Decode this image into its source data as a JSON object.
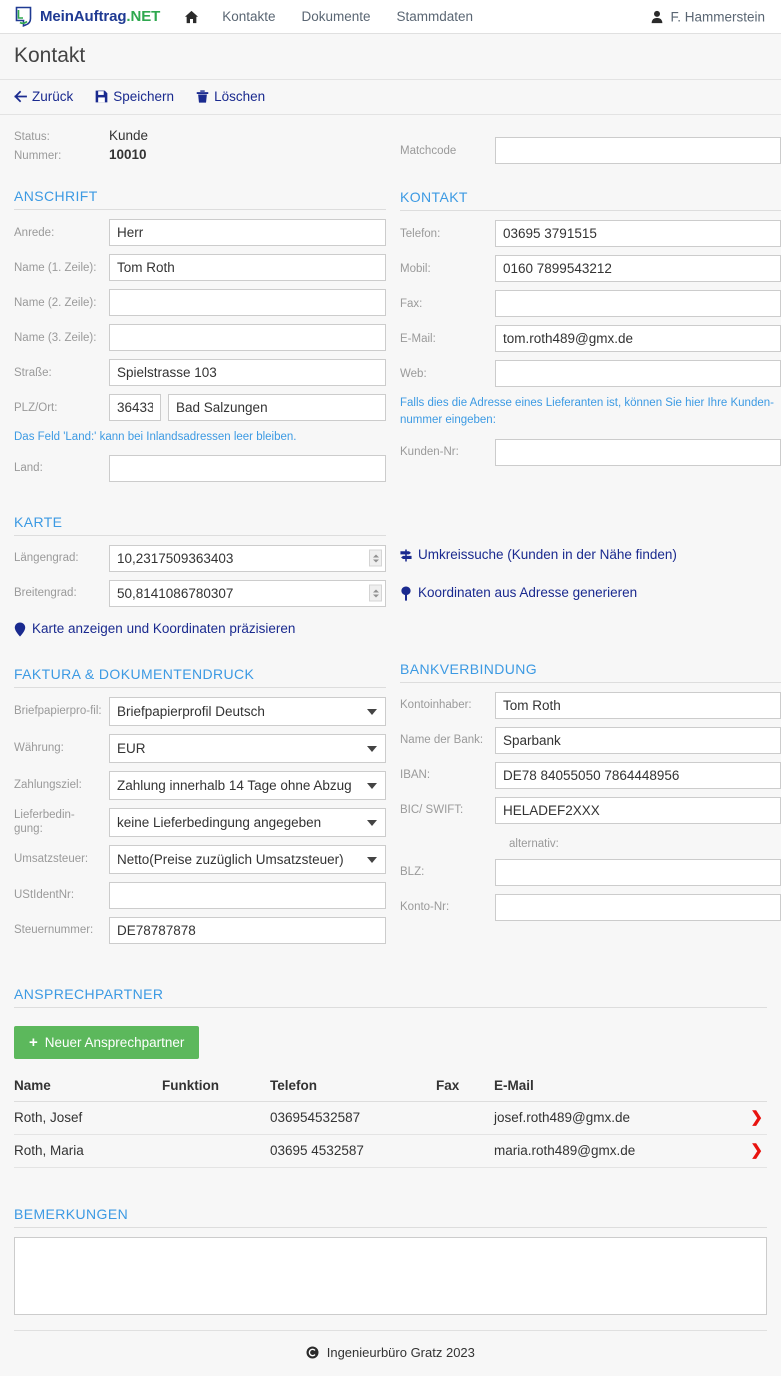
{
  "navbar": {
    "brand_main": "MeinAuftrag",
    "brand_suffix": ".NET",
    "brand_logo_icon": "speech-bubble-logo-icon",
    "home_icon": "home-icon",
    "links": [
      {
        "label": "Kontakte"
      },
      {
        "label": "Dokumente"
      },
      {
        "label": "Stammdaten"
      }
    ],
    "user": {
      "name": "F. Hammerstein",
      "icon": "user-icon"
    }
  },
  "page": {
    "title": "Kontakt"
  },
  "toolbar": {
    "back_label": "Zurück",
    "back_icon": "arrow-left-icon",
    "save_label": "Speichern",
    "save_icon": "floppy-disk-icon",
    "delete_label": "Löschen",
    "delete_icon": "trash-icon"
  },
  "meta": {
    "status_label": "Status:",
    "status_value": "Kunde",
    "number_label": "Nummer:",
    "number_value": "10010"
  },
  "matchcode": {
    "label": "Matchcode",
    "value": ""
  },
  "anschrift": {
    "title": "ANSCHRIFT",
    "fields": [
      {
        "label": "Anrede:",
        "value": "Herr"
      },
      {
        "label": "Name (1. Zeile):",
        "value": "Tom Roth"
      },
      {
        "label": "Name (2. Zeile):",
        "value": ""
      },
      {
        "label": "Name (3. Zeile):",
        "value": ""
      },
      {
        "label": "Straße:",
        "value": "Spielstrasse 103"
      }
    ],
    "plz_label": "PLZ/Ort:",
    "plz_value": "36433",
    "ort_value": "Bad Salzungen",
    "land_hint": "Das Feld 'Land:' kann bei Inlandsadressen leer bleiben.",
    "land_label": "Land:",
    "land_value": ""
  },
  "kontakt": {
    "title": "KONTAKT",
    "fields": [
      {
        "label": "Telefon:",
        "value": "03695 3791515"
      },
      {
        "label": "Mobil:",
        "value": "0160 7899543212"
      },
      {
        "label": "Fax:",
        "value": ""
      },
      {
        "label": "E-Mail:",
        "value": "tom.roth489@gmx.de"
      },
      {
        "label": "Web:",
        "value": ""
      }
    ],
    "supplier_hint": "Falls dies die Adresse eines Lieferanten ist, können Sie hier Ihre Kunden-nummer eingeben:",
    "kundennr_label": "Kunden-Nr:",
    "kundennr_value": ""
  },
  "karte": {
    "title": "KARTE",
    "lon_label": "Längengrad:",
    "lon_value": "10,2317509363403",
    "lat_label": "Breitengrad:",
    "lat_value": "50,8141086780307",
    "show_map_link": "Karte anzeigen und Koordinaten präzisieren",
    "show_map_icon": "map-pin-icon",
    "radius_link": "Umkreissuche (Kunden in der Nähe finden)",
    "radius_icon": "signpost-icon",
    "generate_link": "Koordinaten aus Adresse generieren",
    "generate_icon": "map-pin-icon"
  },
  "faktura": {
    "title": "FAKTURA & DOKUMENTENDRUCK",
    "selects": [
      {
        "label": "Briefpapierpro-fil:",
        "value": "Briefpapierprofil Deutsch"
      },
      {
        "label": "Währung:",
        "value": "EUR"
      },
      {
        "label": "Zahlungsziel:",
        "value": "Zahlung innerhalb 14 Tage ohne Abzug"
      },
      {
        "label": "Lieferbedin-gung:",
        "value": "keine Lieferbedingung angegeben"
      },
      {
        "label": "Umsatzsteuer:",
        "value": "Netto(Preise zuzüglich Umsatzsteuer)"
      }
    ],
    "inputs": [
      {
        "label": "UStIdentNr:",
        "value": ""
      },
      {
        "label": "Steuernummer:",
        "value": "DE78787878"
      }
    ]
  },
  "bank": {
    "title": "BANKVERBINDUNG",
    "fields": [
      {
        "label": "Kontoinhaber:",
        "value": "Tom Roth"
      },
      {
        "label": "Name der Bank:",
        "value": "Sparbank"
      },
      {
        "label": "IBAN:",
        "value": "DE78 84055050 7864448956"
      },
      {
        "label": "BIC/ SWIFT:",
        "value": "HELADEF2XXX"
      }
    ],
    "alternative_label": "alternativ:",
    "alt_fields": [
      {
        "label": "BLZ:",
        "value": ""
      },
      {
        "label": "Konto-Nr:",
        "value": ""
      }
    ]
  },
  "ansprechpartner": {
    "title": "ANSPRECHPARTNER",
    "new_button": "Neuer Ansprechpartner",
    "new_button_icon": "plus-icon",
    "columns": [
      "Name",
      "Funktion",
      "Telefon",
      "Fax",
      "E-Mail"
    ],
    "rows": [
      {
        "name": "Roth, Josef",
        "funktion": "",
        "telefon": "036954532587",
        "fax": "",
        "email": "josef.roth489@gmx.de",
        "action_icon": "chevron-right-icon"
      },
      {
        "name": "Roth, Maria",
        "funktion": "",
        "telefon": "03695 4532587",
        "fax": "",
        "email": "maria.roth489@gmx.de",
        "action_icon": "chevron-right-icon"
      }
    ]
  },
  "bemerkungen": {
    "title": "BEMERKUNGEN",
    "value": ""
  },
  "footer": {
    "copyright_icon": "copyright-icon",
    "text": "Ingenieurbüro Gratz 2023"
  },
  "colors": {
    "brand_blue": "#1f3a93",
    "brand_green": "#2fa84f",
    "section_heading": "#3c9ae3",
    "link_navy": "#1a2a8f",
    "button_green": "#5cb85c",
    "chevron_red": "#e8130f",
    "label_gray": "#9a9a9a"
  }
}
